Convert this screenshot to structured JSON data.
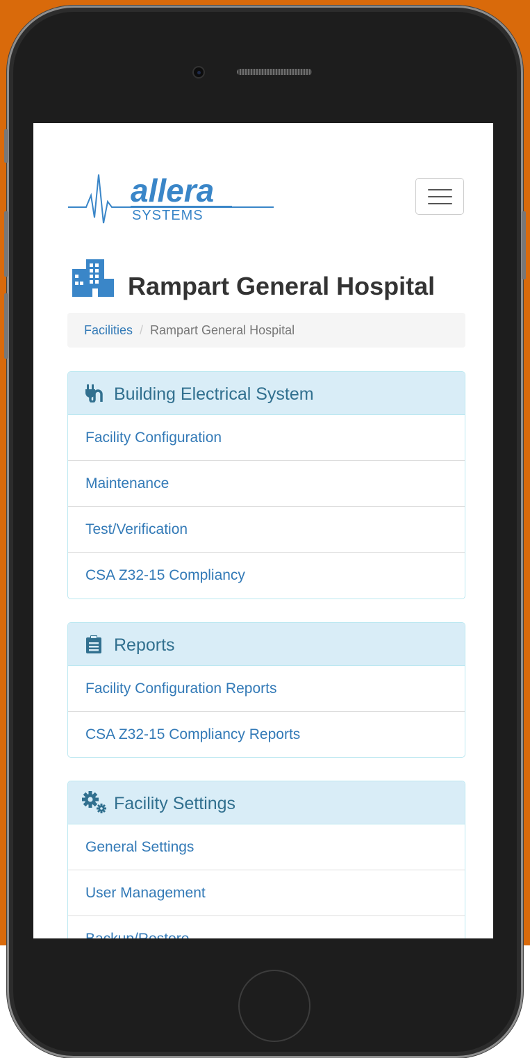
{
  "logo": {
    "word": "allera",
    "sub": "SYSTEMS"
  },
  "page": {
    "title": "Rampart General Hospital"
  },
  "breadcrumb": {
    "facilities": "Facilities",
    "separator": "/",
    "current": "Rampart General Hospital"
  },
  "panels": {
    "electrical": {
      "icon": "plug-icon",
      "title": "Building Electrical System",
      "items": [
        "Facility Configuration",
        "Maintenance",
        "Test/Verification",
        "CSA Z32-15 Compliancy"
      ]
    },
    "reports": {
      "icon": "clipboard-icon",
      "title": "Reports",
      "items": [
        "Facility Configuration Reports",
        "CSA Z32-15 Compliancy Reports"
      ]
    },
    "settings": {
      "icon": "gears-icon",
      "title": "Facility Settings",
      "items": [
        "General Settings",
        "User Management",
        "Backup/Restore"
      ]
    }
  },
  "colors": {
    "accent": "#337ab7",
    "panel_head_bg": "#d9edf7",
    "panel_head_text": "#31708f",
    "background": "#d96a0b"
  }
}
